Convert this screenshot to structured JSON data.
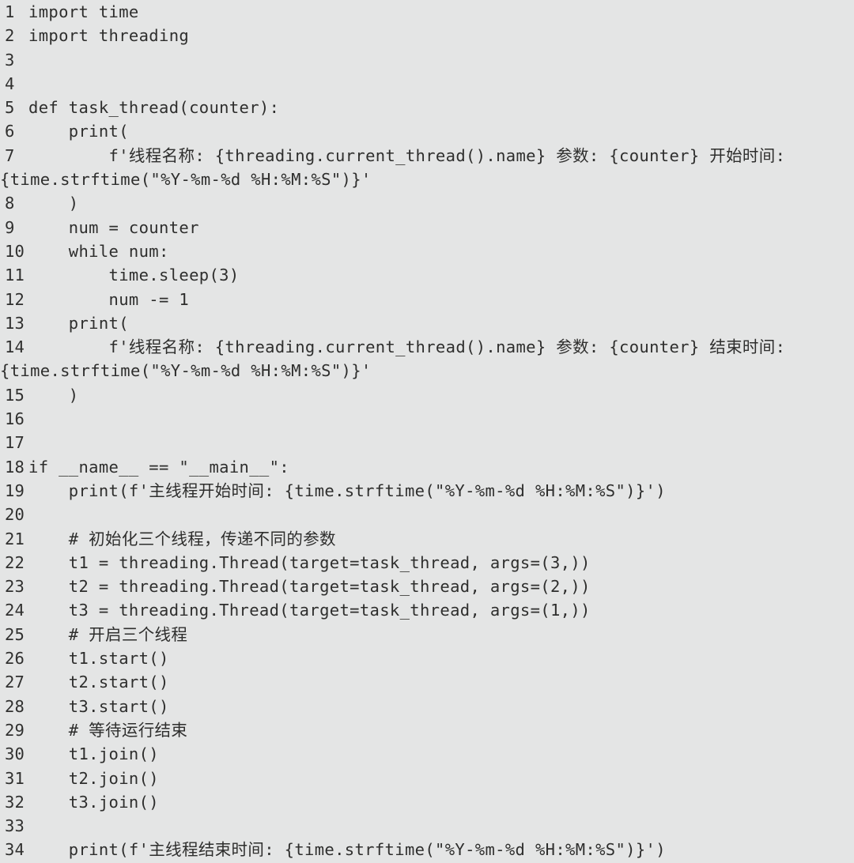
{
  "document": {
    "kind": "code-listing",
    "language": "Python",
    "background_color": "#e4e5e5",
    "text_color": "#2e2e2d",
    "line_number_color": "#30302f",
    "first_line_number": 1,
    "last_line_number": 34
  },
  "lines": [
    {
      "number": "1",
      "text": "import time",
      "continuation": false
    },
    {
      "number": "2",
      "text": "import threading",
      "continuation": false
    },
    {
      "number": "3",
      "text": "",
      "continuation": false
    },
    {
      "number": "4",
      "text": "",
      "continuation": false
    },
    {
      "number": "5",
      "text": "def task_thread(counter):",
      "continuation": false
    },
    {
      "number": "6",
      "text": "    print(",
      "continuation": false
    },
    {
      "number": "7",
      "text": "        f'线程名称: {threading.current_thread().name} 参数: {counter} 开始时间:",
      "continuation": false
    },
    {
      "number": "",
      "text": "{time.strftime(\"%Y-%m-%d %H:%M:%S\")}'",
      "continuation": true
    },
    {
      "number": "8",
      "text": "    )",
      "continuation": false
    },
    {
      "number": "9",
      "text": "    num = counter",
      "continuation": false
    },
    {
      "number": "10",
      "text": "    while num:",
      "continuation": false
    },
    {
      "number": "11",
      "text": "        time.sleep(3)",
      "continuation": false
    },
    {
      "number": "12",
      "text": "        num -= 1",
      "continuation": false
    },
    {
      "number": "13",
      "text": "    print(",
      "continuation": false
    },
    {
      "number": "14",
      "text": "        f'线程名称: {threading.current_thread().name} 参数: {counter} 结束时间:",
      "continuation": false
    },
    {
      "number": "",
      "text": "{time.strftime(\"%Y-%m-%d %H:%M:%S\")}'",
      "continuation": true
    },
    {
      "number": "15",
      "text": "    )",
      "continuation": false
    },
    {
      "number": "16",
      "text": "",
      "continuation": false
    },
    {
      "number": "17",
      "text": "",
      "continuation": false
    },
    {
      "number": "18",
      "text": "if __name__ == \"__main__\":",
      "continuation": false
    },
    {
      "number": "19",
      "text": "    print(f'主线程开始时间: {time.strftime(\"%Y-%m-%d %H:%M:%S\")}')",
      "continuation": false
    },
    {
      "number": "20",
      "text": "",
      "continuation": false
    },
    {
      "number": "21",
      "text": "    # 初始化三个线程，传递不同的参数",
      "continuation": false
    },
    {
      "number": "22",
      "text": "    t1 = threading.Thread(target=task_thread, args=(3,))",
      "continuation": false
    },
    {
      "number": "23",
      "text": "    t2 = threading.Thread(target=task_thread, args=(2,))",
      "continuation": false
    },
    {
      "number": "24",
      "text": "    t3 = threading.Thread(target=task_thread, args=(1,))",
      "continuation": false
    },
    {
      "number": "25",
      "text": "    # 开启三个线程",
      "continuation": false
    },
    {
      "number": "26",
      "text": "    t1.start()",
      "continuation": false
    },
    {
      "number": "27",
      "text": "    t2.start()",
      "continuation": false
    },
    {
      "number": "28",
      "text": "    t3.start()",
      "continuation": false
    },
    {
      "number": "29",
      "text": "    # 等待运行结束",
      "continuation": false
    },
    {
      "number": "30",
      "text": "    t1.join()",
      "continuation": false
    },
    {
      "number": "31",
      "text": "    t2.join()",
      "continuation": false
    },
    {
      "number": "32",
      "text": "    t3.join()",
      "continuation": false
    },
    {
      "number": "33",
      "text": "",
      "continuation": false
    },
    {
      "number": "34",
      "text": "    print(f'主线程结束时间: {time.strftime(\"%Y-%m-%d %H:%M:%S\")}')",
      "continuation": false
    }
  ]
}
